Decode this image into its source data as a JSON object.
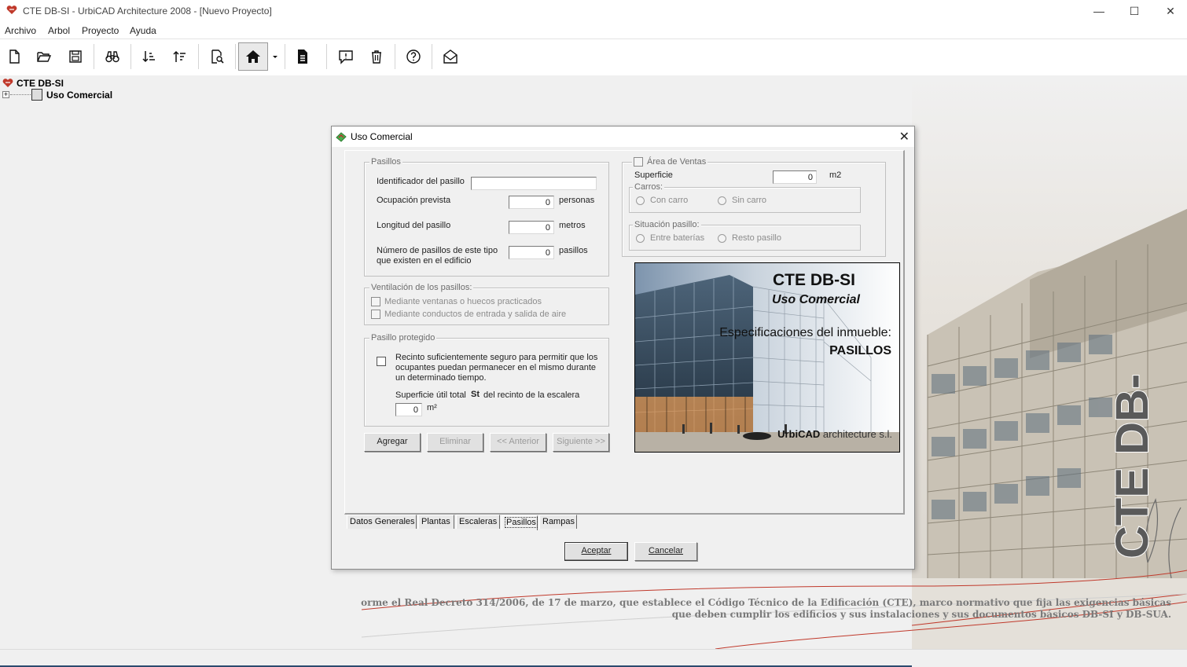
{
  "window": {
    "title": "CTE DB-SI - UrbiCAD Architecture 2008 - [Nuevo Proyecto]",
    "minimize": "—",
    "maximize": "☐",
    "close": "✕"
  },
  "menu": {
    "items": [
      "Archivo",
      "Arbol",
      "Proyecto",
      "Ayuda"
    ]
  },
  "toolbar": {
    "buttons": [
      "new-file-icon",
      "open-folder-icon",
      "save-icon",
      "binoculars-icon",
      "sort-down-icon",
      "sort-up-icon",
      "print-preview-icon",
      "home-icon",
      "dropdown-icon",
      "document-icon",
      "comment-icon",
      "trash-icon",
      "help-icon",
      "mail-icon"
    ]
  },
  "tree": {
    "root": "CTE DB-SI",
    "child": "Uso Comercial",
    "expander": "+"
  },
  "background": {
    "footer_line1": "orme el Real Decreto 314/2006, de 17 de marzo, que establece el Código Técnico de la Edificación (CTE), marco normativo que fija las exigencias básicas",
    "footer_line2": "que deben cumplir los edificios y sus instalaciones y sus documentos básicos DB-SI y DB-SUA.",
    "vertical_brand": "CTE DB-SI"
  },
  "dialog": {
    "title": "Uso Comercial",
    "close": "✕",
    "pasillos": {
      "group": "Pasillos",
      "id_label": "Identificador del pasillo",
      "id_value": "",
      "ocupacion_label": "Ocupación prevista",
      "ocupacion_value": "0",
      "ocupacion_unit": "personas",
      "longitud_label": "Longitud del pasillo",
      "longitud_value": "0",
      "longitud_unit": "metros",
      "numero_label_1": "Número de pasillos de este tipo",
      "numero_label_2": "que existen en el edificio",
      "numero_value": "0",
      "numero_unit": "pasillos"
    },
    "ventilacion": {
      "group": "Ventilación de los pasillos:",
      "opt1": "Mediante ventanas o huecos practicados",
      "opt2": "Mediante conductos de entrada y salida de aire"
    },
    "protegido": {
      "group": "Pasillo protegido",
      "desc_1": "Recinto suficientemente seguro para permitir que los",
      "desc_2": "ocupantes puedan permanecer en el mismo durante",
      "desc_3": "un determinado tiempo.",
      "sup_label": "Superficie útil total",
      "sup_symbol": "St",
      "sup_suffix": "del recinto de la escalera",
      "sup_value": "0",
      "sup_unit": "m²"
    },
    "ventas": {
      "group": "Área de Ventas",
      "superficie_label": "Superficie",
      "superficie_value": "0",
      "superficie_unit": "m2",
      "carros_group": "Carros:",
      "con_carro": "Con carro",
      "sin_carro": "Sin carro",
      "situacion_group": "Situación pasillo:",
      "entre": "Entre baterías",
      "resto": "Resto pasillo"
    },
    "banner": {
      "title": "CTE DB-SI",
      "subtitle": "Uso Comercial",
      "spec": "Especificaciones del inmueble:",
      "section": "PASILLOS",
      "logo_bold": "UrbiCAD",
      "logo_rest": " architecture s.l."
    },
    "buttons": {
      "agregar": "Agregar",
      "eliminar": "Eliminar",
      "anterior": "<< Anterior",
      "siguiente": "Siguiente >>",
      "aceptar": "Aceptar",
      "cancelar": "Cancelar"
    },
    "tabs": [
      "Datos Generales",
      "Plantas",
      "Escaleras",
      "Pasillos",
      "Rampas"
    ],
    "active_tab": "Pasillos"
  },
  "colors": {
    "accent_blue": "#2c4a6e",
    "window_bg": "#f0f0f0"
  }
}
